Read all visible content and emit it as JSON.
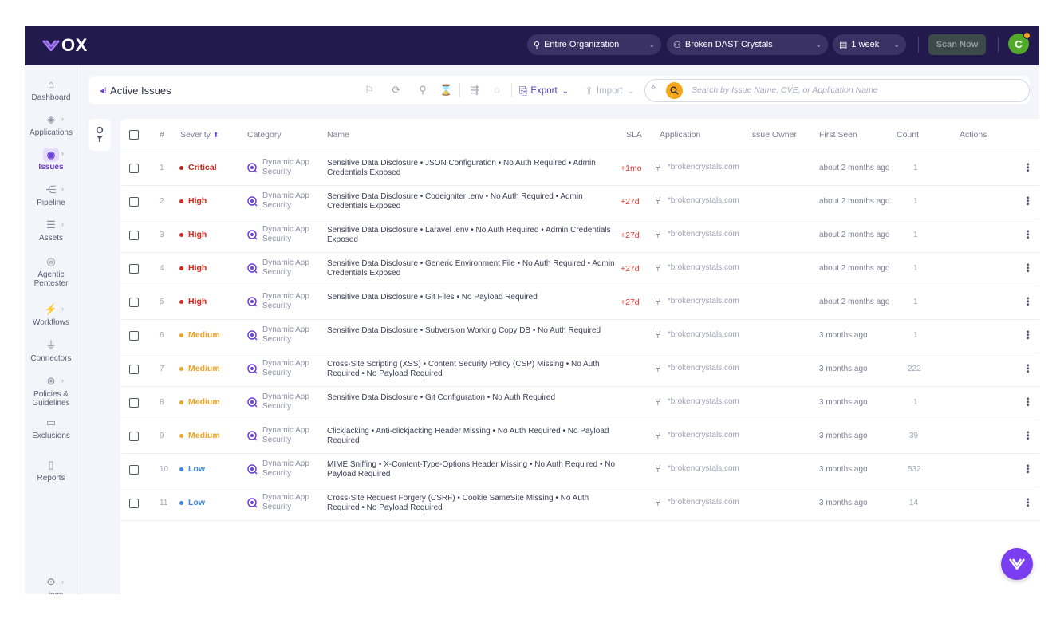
{
  "brand": {
    "name": "OX",
    "accent": "#6c3dd9",
    "nav_bg": "#221a4c"
  },
  "topbar": {
    "org_filter": "Entire Organization",
    "app_filter": "Broken DAST Crystals",
    "time_filter": "1 week",
    "scan_now": "Scan Now",
    "user_initial": "C"
  },
  "sidebar": {
    "items": [
      {
        "label": "Dashboard",
        "icon": "home-icon"
      },
      {
        "label": "Applications",
        "icon": "applications-icon"
      },
      {
        "label": "Issues",
        "icon": "issues-icon",
        "active": true
      },
      {
        "label": "Pipeline",
        "icon": "pipeline-icon"
      },
      {
        "label": "Assets",
        "icon": "assets-icon"
      },
      {
        "label": "Agentic Pentester",
        "icon": "pentester-icon"
      },
      {
        "label": "Workflows",
        "icon": "workflows-icon"
      },
      {
        "label": "Connectors",
        "icon": "plug-icon"
      },
      {
        "label": "Policies & Guidelines",
        "icon": "policies-icon"
      },
      {
        "label": "Exclusions",
        "icon": "exclusions-icon"
      },
      {
        "label": "Reports",
        "icon": "reports-icon"
      }
    ],
    "settings_label": "ings"
  },
  "header": {
    "title": "Active Issues",
    "export_label": "Export",
    "import_label": "Import",
    "search_placeholder": "Search by Issue Name, CVE, or Application Name"
  },
  "table": {
    "columns": {
      "num": "#",
      "severity": "Severity",
      "category": "Category",
      "name": "Name",
      "sla": "SLA",
      "application": "Application",
      "owner": "Issue Owner",
      "first_seen": "First Seen",
      "count": "Count",
      "actions": "Actions"
    },
    "severity_colors": {
      "Critical": "#c0241a",
      "High": "#e0251b",
      "Medium": "#f1a321",
      "Low": "#3f86e8"
    },
    "rows": [
      {
        "num": "1",
        "severity": "Critical",
        "category": "Dynamic App Security",
        "name": "Sensitive Data Disclosure • JSON Configuration • No Auth Required • Admin Credentials Exposed",
        "sla": "+1mo",
        "app": "*brokencrystals.com",
        "first_seen": "about 2 months ago",
        "count": "1"
      },
      {
        "num": "2",
        "severity": "High",
        "category": "Dynamic App Security",
        "name": "Sensitive Data Disclosure • Codeigniter .env • No Auth Required • Admin Credentials Exposed",
        "sla": "+27d",
        "app": "*brokencrystals.com",
        "first_seen": "about 2 months ago",
        "count": "1"
      },
      {
        "num": "3",
        "severity": "High",
        "category": "Dynamic App Security",
        "name": "Sensitive Data Disclosure • Laravel .env • No Auth Required • Admin Credentials Exposed",
        "sla": "+27d",
        "app": "*brokencrystals.com",
        "first_seen": "about 2 months ago",
        "count": "1"
      },
      {
        "num": "4",
        "severity": "High",
        "category": "Dynamic App Security",
        "name": "Sensitive Data Disclosure • Generic Environment File • No Auth Required • Admin Credentials Exposed",
        "sla": "+27d",
        "app": "*brokencrystals.com",
        "first_seen": "about 2 months ago",
        "count": "1"
      },
      {
        "num": "5",
        "severity": "High",
        "category": "Dynamic App Security",
        "name": "Sensitive Data Disclosure • Git Files • No Payload Required",
        "sla": "+27d",
        "app": "*brokencrystals.com",
        "first_seen": "about 2 months ago",
        "count": "1"
      },
      {
        "num": "6",
        "severity": "Medium",
        "category": "Dynamic App Security",
        "name": "Sensitive Data Disclosure • Subversion Working Copy DB • No Auth Required",
        "sla": "",
        "app": "*brokencrystals.com",
        "first_seen": "3 months ago",
        "count": "1"
      },
      {
        "num": "7",
        "severity": "Medium",
        "category": "Dynamic App Security",
        "name": "Cross-Site Scripting (XSS) • Content Security Policy (CSP) Missing • No Auth Required • No Payload Required",
        "sla": "",
        "app": "*brokencrystals.com",
        "first_seen": "3 months ago",
        "count": "222"
      },
      {
        "num": "8",
        "severity": "Medium",
        "category": "Dynamic App Security",
        "name": "Sensitive Data Disclosure • Git Configuration • No Auth Required",
        "sla": "",
        "app": "*brokencrystals.com",
        "first_seen": "3 months ago",
        "count": "1"
      },
      {
        "num": "9",
        "severity": "Medium",
        "category": "Dynamic App Security",
        "name": "Clickjacking • Anti-clickjacking Header Missing • No Auth Required • No Payload Required",
        "sla": "",
        "app": "*brokencrystals.com",
        "first_seen": "3 months ago",
        "count": "39"
      },
      {
        "num": "10",
        "severity": "Low",
        "category": "Dynamic App Security",
        "name": "MIME Sniffing • X-Content-Type-Options Header Missing • No Auth Required • No Payload Required",
        "sla": "",
        "app": "*brokencrystals.com",
        "first_seen": "3 months ago",
        "count": "532"
      },
      {
        "num": "11",
        "severity": "Low",
        "category": "Dynamic App Security",
        "name": "Cross-Site Request Forgery (CSRF) • Cookie SameSite Missing • No Auth Required • No Payload Required",
        "sla": "",
        "app": "*brokencrystals.com",
        "first_seen": "3 months ago",
        "count": "14"
      }
    ]
  }
}
